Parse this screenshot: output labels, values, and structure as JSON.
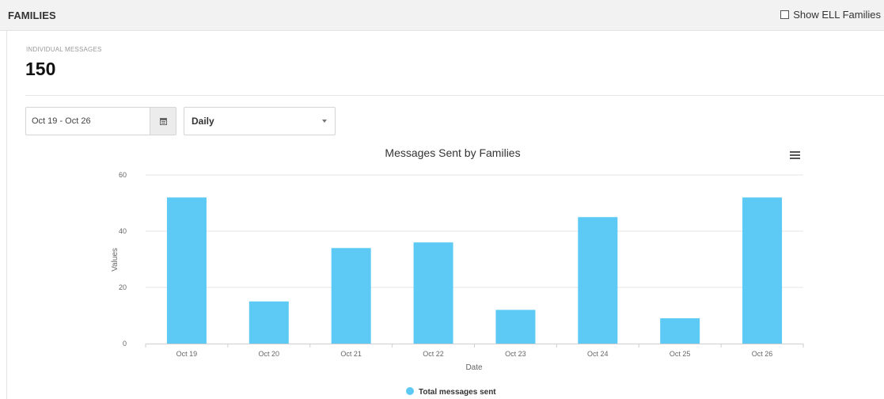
{
  "section": {
    "title": "FAMILIES",
    "ell_toggle_label": "Show ELL Families",
    "ell_toggle_checked": false
  },
  "stats": {
    "label": "INDIVIDUAL MESSAGES",
    "value": "150"
  },
  "filters": {
    "date_range": "Oct 19 - Oct 26",
    "calendar_icon": "calendar-icon",
    "period": "Daily",
    "period_icon": "chevron-down-icon"
  },
  "chart_menu_icon": "hamburger-menu-icon",
  "colors": {
    "bar": "#5ccaf4",
    "grid": "#e6e6e6"
  },
  "chart_data": {
    "type": "bar",
    "title": "Messages Sent by Families",
    "xlabel": "Date",
    "ylabel": "Values",
    "categories": [
      "Oct 19",
      "Oct 20",
      "Oct 21",
      "Oct 22",
      "Oct 23",
      "Oct 24",
      "Oct 25",
      "Oct 26"
    ],
    "series": [
      {
        "name": "Total messages sent",
        "values": [
          52,
          15,
          34,
          36,
          12,
          45,
          9,
          52
        ]
      }
    ],
    "ylim": [
      0,
      60
    ],
    "yticks": [
      0,
      20,
      40,
      60
    ],
    "grid": true,
    "legend": "bottom-center"
  }
}
